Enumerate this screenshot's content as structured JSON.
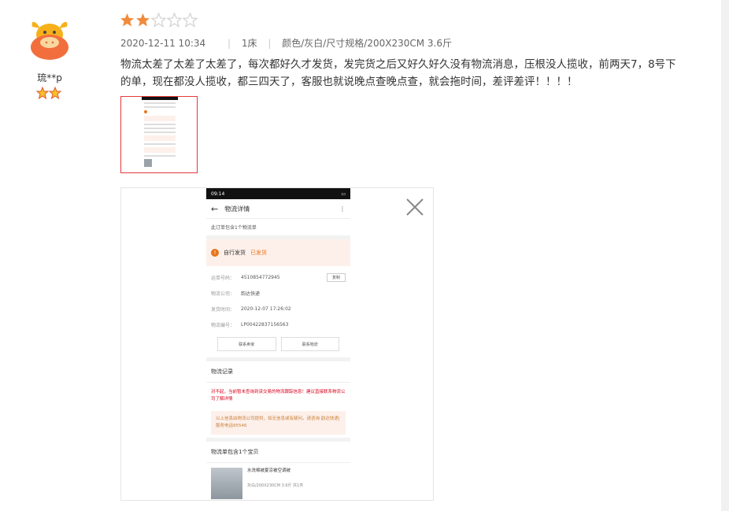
{
  "user": {
    "name": "琉**p",
    "badge_count": 2
  },
  "rating": {
    "value": 2,
    "max": 5,
    "filled_color": "#f08b3b",
    "empty_color": "#d4d4d4"
  },
  "meta": {
    "date": "2020-12-11 10:34",
    "qty": "1床",
    "spec": "颜色/灰白/尺寸规格/200X230CM 3.6斤"
  },
  "comment": {
    "text": "物流太差了太差了太差了，每次都好久才发货，发完货之后又好久好久没有物流消息，压根没人揽收，前两天7，8号下的单，现在都没人揽收，都三四天了，客服也就说晚点查晚点查，就会拖时间，差评差评！！！！"
  },
  "preview": {
    "status_time": "09:14",
    "header_title": "物流详情",
    "sub": "此订单包含1个物流单",
    "alert_label": "自行发货",
    "alert_status": "已发货",
    "rows": [
      {
        "key": "运单号码：",
        "value": "4510854772945"
      },
      {
        "key": "物流公司：",
        "value": "韵达快递"
      },
      {
        "key": "发货时间：",
        "value": "2020-12-07 17:26:02"
      },
      {
        "key": "物流编号：",
        "value": "LP00422837156563"
      }
    ],
    "copy_label": "复制",
    "btn_seller": "联系卖家",
    "btn_logistics": "联系物流",
    "section_records": "物流记录",
    "warn_text": "对不起，当前暂未查询到该交易的物流跟踪信息！建议直接联系物流公司了解详情",
    "note_text": "以上信息由物流公司提供，如无信息或有疑问，请咨询 韵达快递|服务电话95546",
    "section_items": "物流单包含1个宝贝",
    "item_title": "水洗棉被夏凉被空调被",
    "item_spec": "灰白/200X230CM 3.6斤  共1件"
  }
}
